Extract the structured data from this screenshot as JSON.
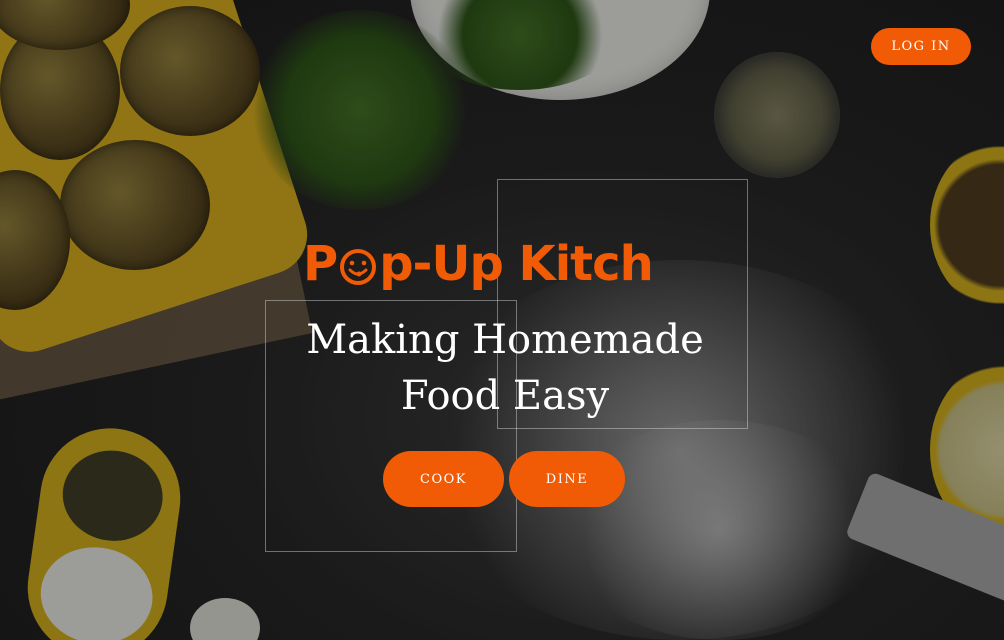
{
  "header": {
    "login_label": "LOG IN"
  },
  "hero": {
    "logo_before": "P",
    "logo_after": "p-Up Kitch",
    "logo_icon": "smiley-face-icon",
    "tagline_line1": "Making Homemade",
    "tagline_line2": "Food Easy"
  },
  "actions": {
    "cook_label": "COOK",
    "dine_label": "DINE"
  },
  "colors": {
    "accent": "#f25b05",
    "background": "#1f1f1f",
    "text": "#ffffff"
  }
}
